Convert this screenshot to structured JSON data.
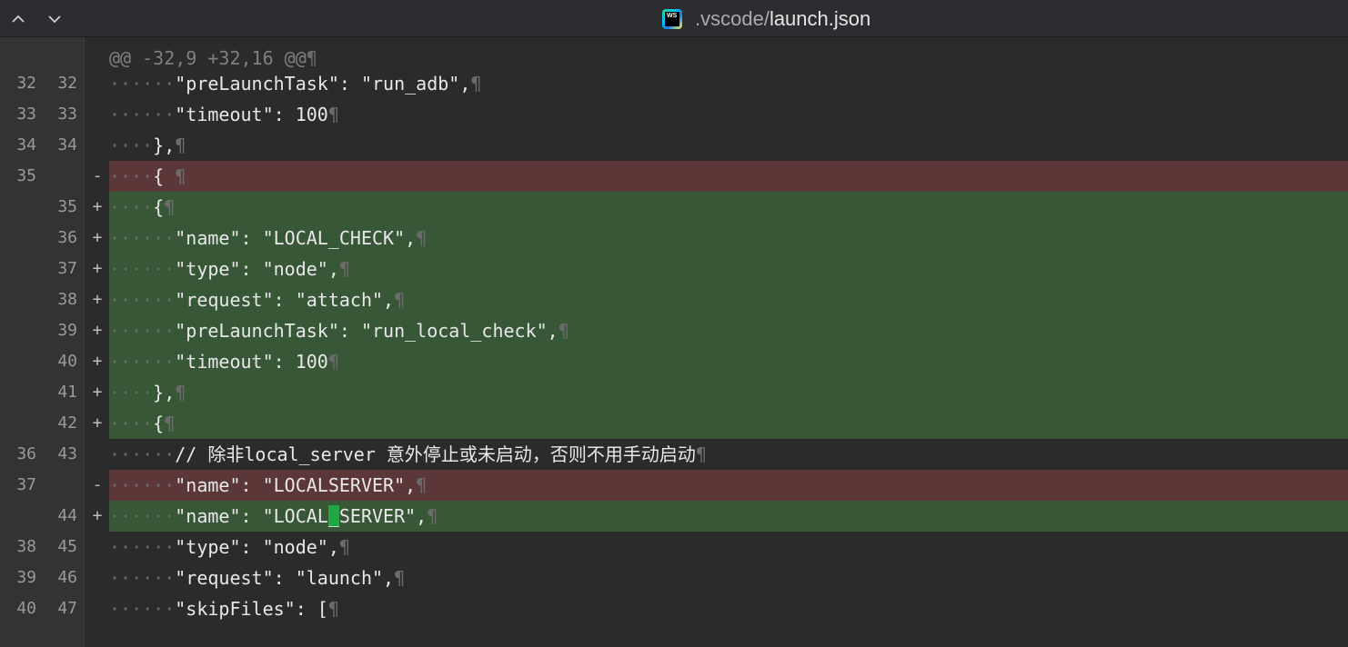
{
  "header": {
    "nav_up_icon": "chevron-up-icon",
    "nav_down_icon": "chevron-down-icon",
    "file_icon": "webstorm-icon",
    "file_icon_text": "WS",
    "dir": ".vscode/",
    "file": "launch.json"
  },
  "hunk_header": "@@ -32,9 +32,16 @@",
  "pilcrow": "¶",
  "rows": [
    {
      "type": "ctx",
      "old": "32",
      "new": "32",
      "marker": "",
      "indent": "······",
      "code": "\"preLaunchTask\": \"run_adb\","
    },
    {
      "type": "ctx",
      "old": "33",
      "new": "33",
      "marker": "",
      "indent": "······",
      "code": "\"timeout\": 100"
    },
    {
      "type": "ctx",
      "old": "34",
      "new": "34",
      "marker": "",
      "indent": "····",
      "code": "},"
    },
    {
      "type": "del",
      "old": "35",
      "new": "",
      "marker": "-",
      "indent": "····",
      "code": "{ "
    },
    {
      "type": "add",
      "old": "",
      "new": "35",
      "marker": "+",
      "indent": "····",
      "code": "{"
    },
    {
      "type": "add",
      "old": "",
      "new": "36",
      "marker": "+",
      "indent": "······",
      "code": "\"name\": \"LOCAL_CHECK\","
    },
    {
      "type": "add",
      "old": "",
      "new": "37",
      "marker": "+",
      "indent": "······",
      "code": "\"type\": \"node\","
    },
    {
      "type": "add",
      "old": "",
      "new": "38",
      "marker": "+",
      "indent": "······",
      "code": "\"request\": \"attach\","
    },
    {
      "type": "add",
      "old": "",
      "new": "39",
      "marker": "+",
      "indent": "······",
      "code": "\"preLaunchTask\": \"run_local_check\","
    },
    {
      "type": "add",
      "old": "",
      "new": "40",
      "marker": "+",
      "indent": "······",
      "code": "\"timeout\": 100"
    },
    {
      "type": "add",
      "old": "",
      "new": "41",
      "marker": "+",
      "indent": "····",
      "code": "},"
    },
    {
      "type": "add",
      "old": "",
      "new": "42",
      "marker": "+",
      "indent": "····",
      "code": "{"
    },
    {
      "type": "ctx",
      "old": "36",
      "new": "43",
      "marker": "",
      "indent": "······",
      "code": "// 除非local_server 意外停止或未启动，否则不用手动启动"
    },
    {
      "type": "del",
      "old": "37",
      "new": "",
      "marker": "-",
      "indent": "······",
      "code": "\"name\": \"LOCALSERVER\","
    },
    {
      "type": "add",
      "old": "",
      "new": "44",
      "marker": "+",
      "indent": "······",
      "code_pre": "\"name\": \"LOCAL",
      "code_hl": "_",
      "code_post": "SERVER\","
    },
    {
      "type": "ctx",
      "old": "38",
      "new": "45",
      "marker": "",
      "indent": "······",
      "code": "\"type\": \"node\","
    },
    {
      "type": "ctx",
      "old": "39",
      "new": "46",
      "marker": "",
      "indent": "······",
      "code": "\"request\": \"launch\","
    },
    {
      "type": "ctx",
      "old": "40",
      "new": "47",
      "marker": "",
      "indent": "······",
      "code": "\"skipFiles\": ["
    }
  ]
}
